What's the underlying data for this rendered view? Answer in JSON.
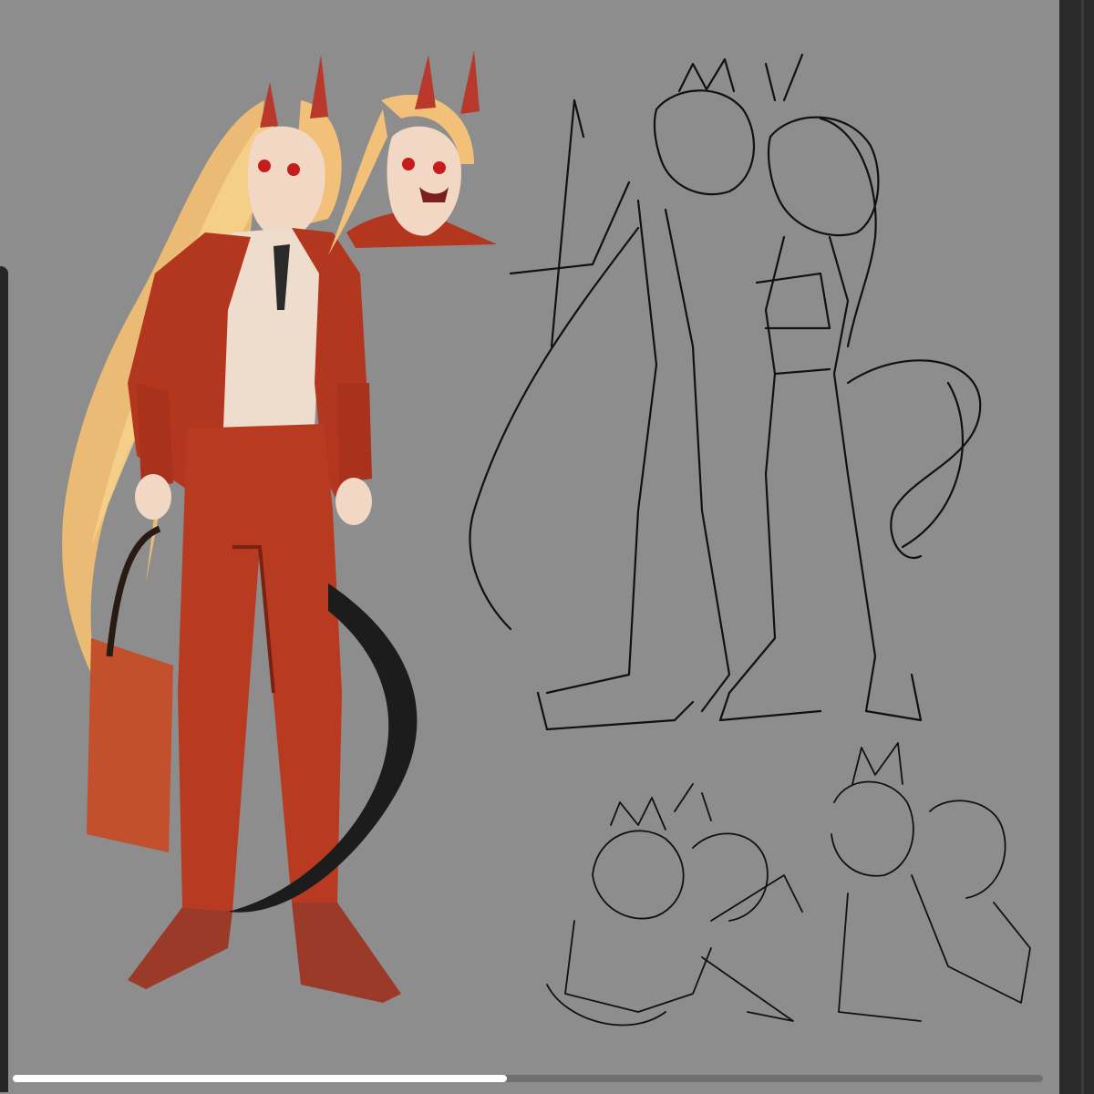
{
  "app": {
    "canvas_color": "#8d8d8d",
    "panel_color": "#2a2a2a",
    "accent_suit": "#b23a1e",
    "accent_hair": "#f2c079"
  },
  "icons": [
    "scroll-handle-icon"
  ],
  "scroll": {
    "position_fraction": 0.0,
    "thumb_fraction": 0.48
  }
}
